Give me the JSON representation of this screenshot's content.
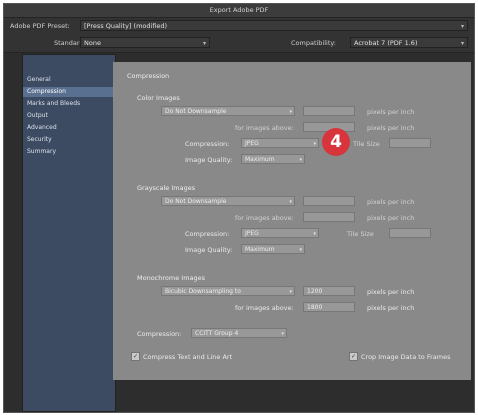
{
  "window": {
    "title": "Export Adobe PDF"
  },
  "preset": {
    "label": "Adobe PDF Preset:",
    "value": "[Press Quality] (modified)"
  },
  "standard": {
    "label": "Standard:",
    "value": "None"
  },
  "compatibility": {
    "label": "Compatibility:",
    "value": "Acrobat 7 (PDF 1.6)"
  },
  "sidebar": {
    "items": [
      {
        "label": "General"
      },
      {
        "label": "Compression"
      },
      {
        "label": "Marks and Bleeds"
      },
      {
        "label": "Output"
      },
      {
        "label": "Advanced"
      },
      {
        "label": "Security"
      },
      {
        "label": "Summary"
      }
    ],
    "active_index": 1
  },
  "panel": {
    "title": "Compression"
  },
  "color_images": {
    "heading": "Color Images",
    "downsample": "Do Not Downsample",
    "ppi_label": "pixels per inch",
    "above_label": "for images above:",
    "above_ppi_label": "pixels per inch",
    "compression_label": "Compression:",
    "compression": "JPEG",
    "tile_size_label": "Tile Size",
    "quality_label": "Image Quality:",
    "quality": "Maximum"
  },
  "grayscale_images": {
    "heading": "Grayscale Images",
    "downsample": "Do Not Downsample",
    "ppi_label": "pixels per inch",
    "above_label": "for images above:",
    "above_ppi_label": "pixels per inch",
    "compression_label": "Compression:",
    "compression": "JPEG",
    "tile_size_label": "Tile Size",
    "quality_label": "Image Quality:",
    "quality": "Maximum"
  },
  "monochrome_images": {
    "heading": "Monochrome Images",
    "downsample": "Bicubic Downsampling to",
    "ppi_value": "1200",
    "ppi_label": "pixels per inch",
    "above_label": "for images above:",
    "above_value": "1800",
    "above_ppi_label": "pixels per inch",
    "compression_label": "Compression:",
    "compression": "CCITT Group 4"
  },
  "options": {
    "compress_text": "Compress Text and Line Art",
    "crop_image": "Crop Image Data to Frames"
  },
  "badge": {
    "text": "4"
  },
  "colors": {
    "badge": "#d8343c",
    "sidebar": "#3d4b62",
    "sidebar_active": "#5a7090"
  }
}
